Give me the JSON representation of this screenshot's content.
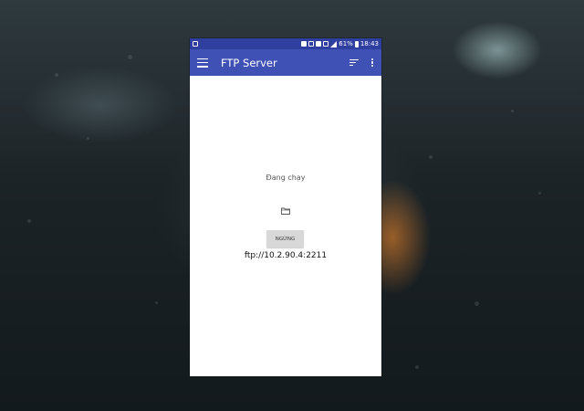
{
  "status_bar": {
    "battery": "61%",
    "time": "18:43"
  },
  "toolbar": {
    "title": "FTP Server",
    "menu_icon": "hamburger-menu-icon",
    "sort_icon": "sort-icon",
    "more_icon": "more-vert-icon"
  },
  "main": {
    "status_text": "Đang chạy",
    "folder_icon": "folder-icon",
    "stop_button_label": "NGỪNG",
    "ftp_url": "ftp://10.2.90.4:2211"
  },
  "colors": {
    "app_bar": "#3f51b5",
    "status_bar": "#2f3fa0",
    "background": "#ffffff",
    "button": "#d8d8d8"
  }
}
